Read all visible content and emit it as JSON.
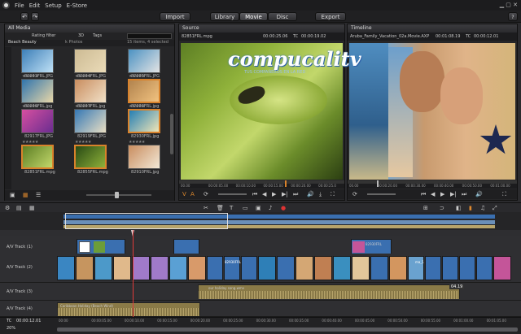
{
  "menu": [
    "File",
    "Edit",
    "Setup",
    "E-Store"
  ],
  "tabs": {
    "import": "Import",
    "library": "Library",
    "movie": "Movie",
    "disc": "Disc",
    "export": "Export"
  },
  "library": {
    "root": "All Media",
    "rating": "Rating filter",
    "tags": "Tags",
    "view3d": "3D",
    "collection": "Beach Beauty",
    "collection_sub": "k Photos",
    "count": "15 items, 4 selected",
    "search_placeholder": "",
    "items": [
      {
        "name": "82903FRL.JPG"
      },
      {
        "name": "82904FRL.JPG"
      },
      {
        "name": "82905FRL.JPG"
      },
      {
        "name": "82906FRL.jpg"
      },
      {
        "name": "82907FRL.jpg"
      },
      {
        "name": "82908FRL.jpg"
      },
      {
        "name": "82917FRL.JPG"
      },
      {
        "name": "82919FRL.JPG"
      },
      {
        "name": "82930FRL.jpg"
      },
      {
        "name": "82851FRL.mpg"
      },
      {
        "name": "82855FRL.mpg"
      },
      {
        "name": "82910FRL.jpg"
      }
    ]
  },
  "source": {
    "title": "Source",
    "file": "82851FRL.mpg",
    "duration": "00:00:25.06",
    "tc": "00:00:19.02",
    "tc_label": "TC",
    "ruler": [
      "00.00",
      "00:00:05.00",
      "00:00:10.00",
      "00:00:15.00",
      "00:00:20.00",
      "00:00:25.0"
    ]
  },
  "timeline_preview": {
    "title": "Timeline",
    "file": "Aruba_Family_Vacation_02a.Movie.AXP",
    "duration": "00:01:08.19",
    "tc": "00:00:12.01",
    "tc_label": "TC",
    "ruler": [
      "00.00",
      "00:00:20.00",
      "00:00:30.00",
      "00:00:40.00",
      "00:00:50.00",
      "00:01:00.00"
    ]
  },
  "watermark": {
    "main": "compucalitv",
    "sub": "TUS COMPAÑEROS EN LA RED"
  },
  "tracks": [
    {
      "name": "A/V Track (1)"
    },
    {
      "name": "A/V Track (2)"
    },
    {
      "name": "A/V Track (3)"
    },
    {
      "name": "A/V Track (4)"
    }
  ],
  "clips": {
    "title_clip": "82930FRL",
    "clip_b": "82930FRL",
    "clip_c": "ma_1",
    "song": "our holiday song.wmv",
    "music": "Caribbean Holiday (Beach Wind)",
    "num": "04.19"
  },
  "footer": {
    "tc_label": "TC",
    "tc": "00:00:12.01",
    "zoom": "20%",
    "ruler": [
      "00:00",
      "00:00:05.00",
      "00:00:10.00",
      "00:00:15.00",
      "00:00:20.00",
      "00:00:25.00",
      "00:00:30.00",
      "00:00:35.00",
      "00:00:40.00",
      "00:00:45.00",
      "00:00:50.00",
      "00:00:55.00",
      "00:01:00.00",
      "00:01:05.00"
    ]
  },
  "colors": {
    "accent": "#d9822b",
    "track_blue": "#3a6fb0",
    "title_purple": "#a07ac9",
    "audio": "#b7a46a"
  }
}
